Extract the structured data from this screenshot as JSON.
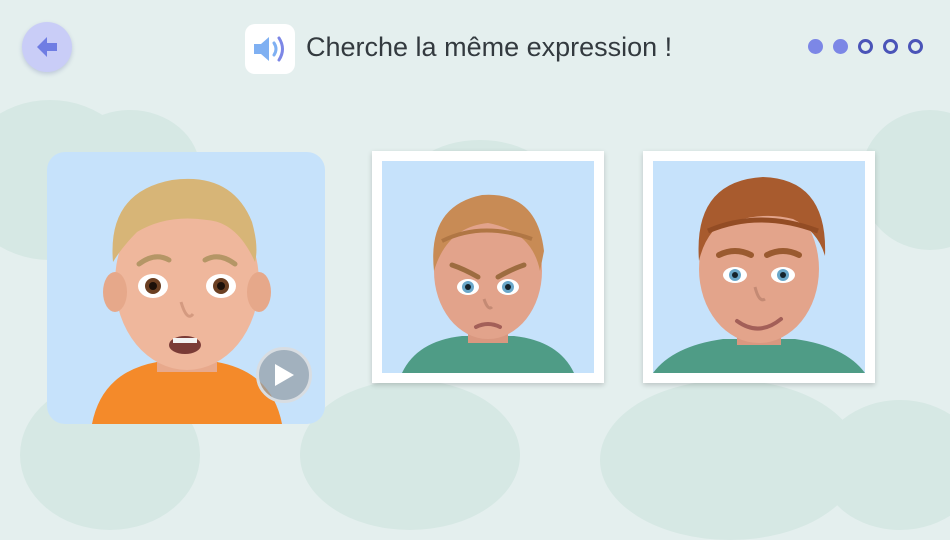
{
  "header": {
    "title": "Cherche la même expression !",
    "back_icon": "arrow-left-icon",
    "speaker_icon": "speaker-icon",
    "accent_color": "#7c87e6"
  },
  "progress": {
    "total_steps": 5,
    "completed_steps": 2
  },
  "model": {
    "icon": "play-icon",
    "expression": "worried boy face"
  },
  "choices": [
    {
      "id": "choice-1",
      "expression": "angry face"
    },
    {
      "id": "choice-2",
      "expression": "smiling face"
    }
  ]
}
